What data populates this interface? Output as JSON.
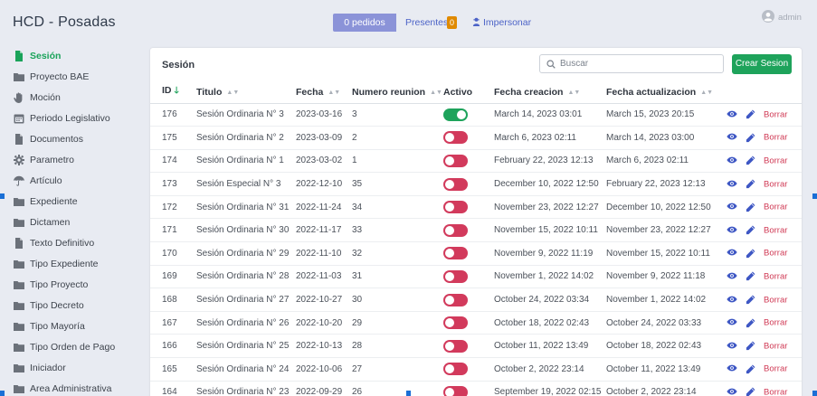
{
  "header": {
    "app_title": "HCD - Posadas",
    "pedidos_label": "0 pedidos",
    "presentes_label": "Presentes",
    "presentes_count": "0",
    "impersonar_label": "Impersonar",
    "user_label": "admin"
  },
  "sidebar": {
    "items": [
      {
        "label": "Sesión",
        "icon": "document-icon",
        "active": true
      },
      {
        "label": "Proyecto BAE",
        "icon": "folder-icon"
      },
      {
        "label": "Moción",
        "icon": "hand-icon"
      },
      {
        "label": "Periodo Legislativo",
        "icon": "calendar-icon"
      },
      {
        "label": "Documentos",
        "icon": "document-icon"
      },
      {
        "label": "Parametro",
        "icon": "gear-icon"
      },
      {
        "label": "Artículo",
        "icon": "umbrella-icon"
      },
      {
        "label": "Expediente",
        "icon": "folder-icon"
      },
      {
        "label": "Dictamen",
        "icon": "folder-icon"
      },
      {
        "label": "Texto Definitivo",
        "icon": "document-icon"
      },
      {
        "label": "Tipo Expediente",
        "icon": "folder-icon"
      },
      {
        "label": "Tipo Proyecto",
        "icon": "folder-icon"
      },
      {
        "label": "Tipo Decreto",
        "icon": "folder-icon"
      },
      {
        "label": "Tipo Mayoría",
        "icon": "folder-icon"
      },
      {
        "label": "Tipo Orden de Pago",
        "icon": "folder-icon"
      },
      {
        "label": "Iniciador",
        "icon": "folder-icon"
      },
      {
        "label": "Area Administrativa",
        "icon": "folder-icon"
      }
    ]
  },
  "main": {
    "card_title": "Sesión",
    "search_placeholder": "Buscar",
    "create_label": "Crear Sesion",
    "columns": [
      "ID",
      "Titulo",
      "Fecha",
      "Numero reunion",
      "Activo",
      "Fecha creacion",
      "Fecha actualizacion"
    ],
    "delete_label": "Borrar",
    "rows": [
      {
        "id": "176",
        "title": "Sesión Ordinaria N° 3",
        "fecha": "2023-03-16",
        "num": "3",
        "active": true,
        "created": "March 14, 2023 03:01",
        "updated": "March 15, 2023 20:15"
      },
      {
        "id": "175",
        "title": "Sesión Ordinaria N° 2",
        "fecha": "2023-03-09",
        "num": "2",
        "active": false,
        "created": "March 6, 2023 02:11",
        "updated": "March 14, 2023 03:00"
      },
      {
        "id": "174",
        "title": "Sesión Ordinaria N° 1",
        "fecha": "2023-03-02",
        "num": "1",
        "active": false,
        "created": "February 22, 2023 12:13",
        "updated": "March 6, 2023 02:11"
      },
      {
        "id": "173",
        "title": "Sesión Especial N° 3",
        "fecha": "2022-12-10",
        "num": "35",
        "active": false,
        "created": "December 10, 2022 12:50",
        "updated": "February 22, 2023 12:13"
      },
      {
        "id": "172",
        "title": "Sesión Ordinaria N° 31",
        "fecha": "2022-11-24",
        "num": "34",
        "active": false,
        "created": "November 23, 2022 12:27",
        "updated": "December 10, 2022 12:50"
      },
      {
        "id": "171",
        "title": "Sesión Ordinaria N° 30",
        "fecha": "2022-11-17",
        "num": "33",
        "active": false,
        "created": "November 15, 2022 10:11",
        "updated": "November 23, 2022 12:27"
      },
      {
        "id": "170",
        "title": "Sesión Ordinaria N° 29",
        "fecha": "2022-11-10",
        "num": "32",
        "active": false,
        "created": "November 9, 2022 11:19",
        "updated": "November 15, 2022 10:11"
      },
      {
        "id": "169",
        "title": "Sesión Ordinaria N° 28",
        "fecha": "2022-11-03",
        "num": "31",
        "active": false,
        "created": "November 1, 2022 14:02",
        "updated": "November 9, 2022 11:18"
      },
      {
        "id": "168",
        "title": "Sesión Ordinaria N° 27",
        "fecha": "2022-10-27",
        "num": "30",
        "active": false,
        "created": "October 24, 2022 03:34",
        "updated": "November 1, 2022 14:02"
      },
      {
        "id": "167",
        "title": "Sesión Ordinaria N° 26",
        "fecha": "2022-10-20",
        "num": "29",
        "active": false,
        "created": "October 18, 2022 02:43",
        "updated": "October 24, 2022 03:33"
      },
      {
        "id": "166",
        "title": "Sesión Ordinaria N° 25",
        "fecha": "2022-10-13",
        "num": "28",
        "active": false,
        "created": "October 11, 2022 13:49",
        "updated": "October 18, 2022 02:43"
      },
      {
        "id": "165",
        "title": "Sesión Ordinaria N° 24",
        "fecha": "2022-10-06",
        "num": "27",
        "active": false,
        "created": "October 2, 2022 23:14",
        "updated": "October 11, 2022 13:49"
      },
      {
        "id": "164",
        "title": "Sesión Ordinaria N° 23",
        "fecha": "2022-09-29",
        "num": "26",
        "active": false,
        "created": "September 19, 2022 02:15",
        "updated": "October 2, 2022 23:14"
      }
    ]
  },
  "colors": {
    "accent_green": "#1ea35b",
    "toggle_off": "#d23a5c",
    "pedidos_bg": "#8b93d8",
    "link_blue": "#4c63c7",
    "badge_orange": "#e08a00"
  }
}
